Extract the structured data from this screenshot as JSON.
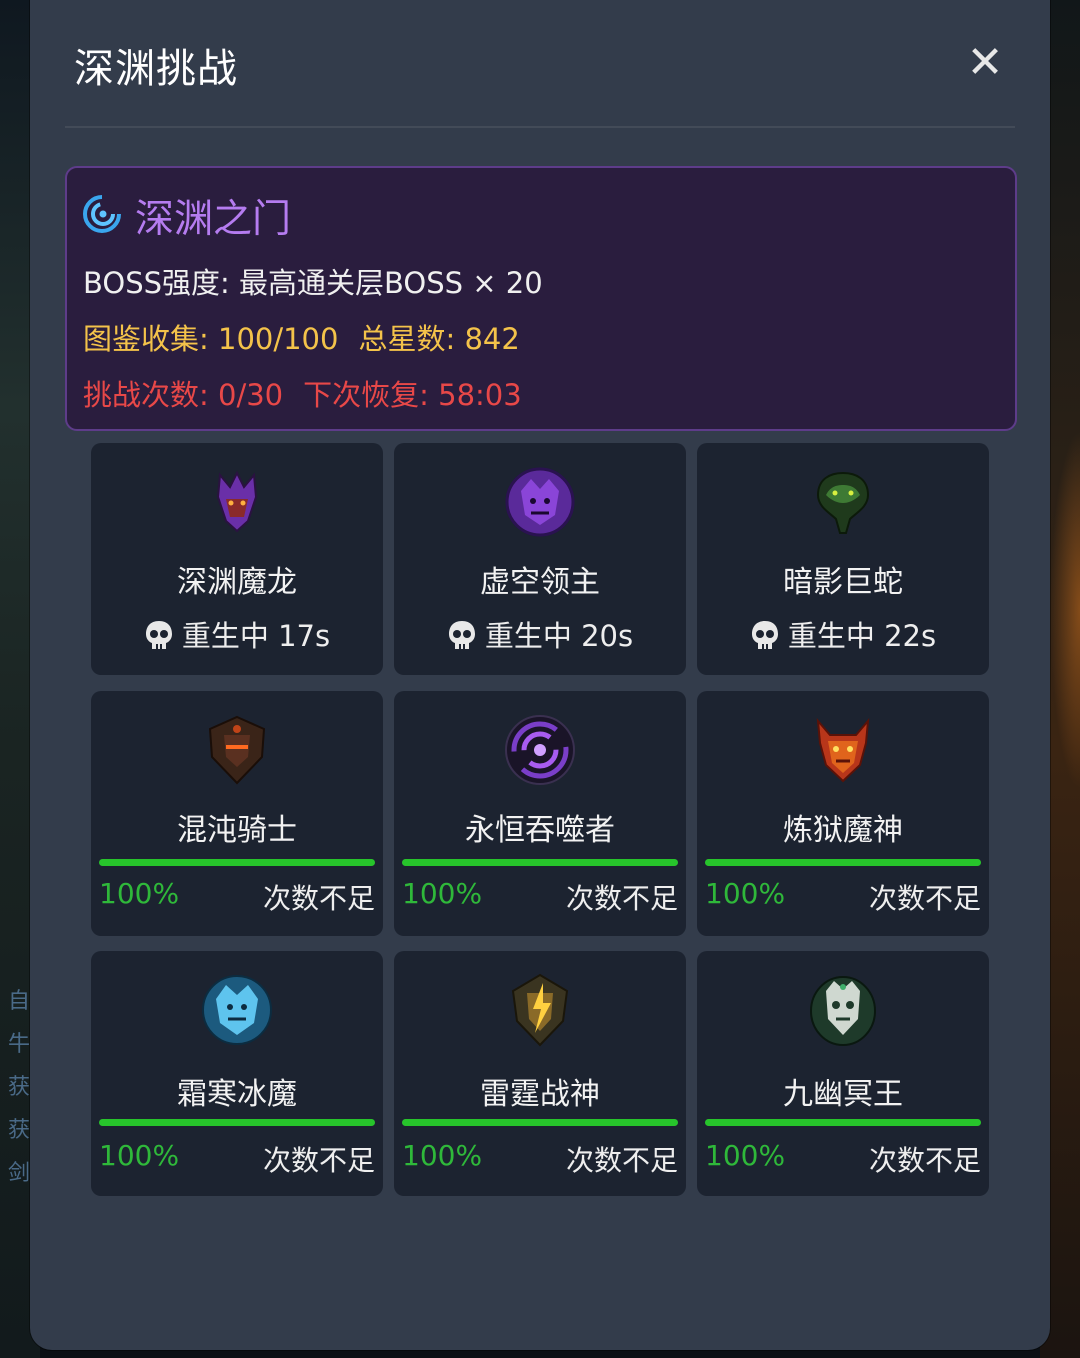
{
  "modal": {
    "title": "深渊挑战"
  },
  "gate": {
    "title": "深渊之门",
    "icon": "swirl-portal-icon",
    "boss_strength": "BOSS强度: 最高通关层BOSS × 20",
    "collection": "图鉴收集: 100/100",
    "total_stars": "总星数: 842",
    "attempts": "挑战次数: 0/30",
    "next_recover": "下次恢复: 58:03"
  },
  "background_text": [
    "自",
    "牛",
    "获",
    "获",
    "剑"
  ],
  "bosses": [
    {
      "name": "深渊魔龙",
      "state": "respawning",
      "respawn": "重生中 17s",
      "portrait": "purple-dragon-portrait",
      "color": "#7a3fc0"
    },
    {
      "name": "虚空领主",
      "state": "respawning",
      "respawn": "重生中 20s",
      "portrait": "void-lord-portrait",
      "color": "#8a45d8"
    },
    {
      "name": "暗影巨蛇",
      "state": "respawning",
      "respawn": "重生中 22s",
      "portrait": "shadow-serpent-portrait",
      "color": "#2f6a2a"
    },
    {
      "name": "混沌骑士",
      "state": "ready",
      "progress": 1.0,
      "percent": "100%",
      "status": "次数不足",
      "portrait": "chaos-knight-portrait",
      "color": "#a0451e"
    },
    {
      "name": "永恒吞噬者",
      "state": "ready",
      "progress": 1.0,
      "percent": "100%",
      "status": "次数不足",
      "portrait": "vortex-devourer-portrait",
      "color": "#9a4ee0"
    },
    {
      "name": "炼狱魔神",
      "state": "ready",
      "progress": 1.0,
      "percent": "100%",
      "status": "次数不足",
      "portrait": "inferno-demon-portrait",
      "color": "#e0541c"
    },
    {
      "name": "霜寒冰魔",
      "state": "ready",
      "progress": 1.0,
      "percent": "100%",
      "status": "次数不足",
      "portrait": "frost-demon-portrait",
      "color": "#3fa8d8"
    },
    {
      "name": "雷霆战神",
      "state": "ready",
      "progress": 1.0,
      "percent": "100%",
      "status": "次数不足",
      "portrait": "thunder-war-god-portrait",
      "color": "#c89a2a"
    },
    {
      "name": "九幽冥王",
      "state": "ready",
      "progress": 1.0,
      "percent": "100%",
      "status": "次数不足",
      "portrait": "nether-king-portrait",
      "color": "#3fae6a"
    }
  ],
  "colors": {
    "modal_bg": "#333c4b",
    "card_bg": "#1c2330",
    "gate_panel_bg": "#2a1d3e",
    "gate_title": "#b57cf0",
    "gold": "#f4c34a",
    "red": "#e84848",
    "progress_green": "#27c42b"
  }
}
